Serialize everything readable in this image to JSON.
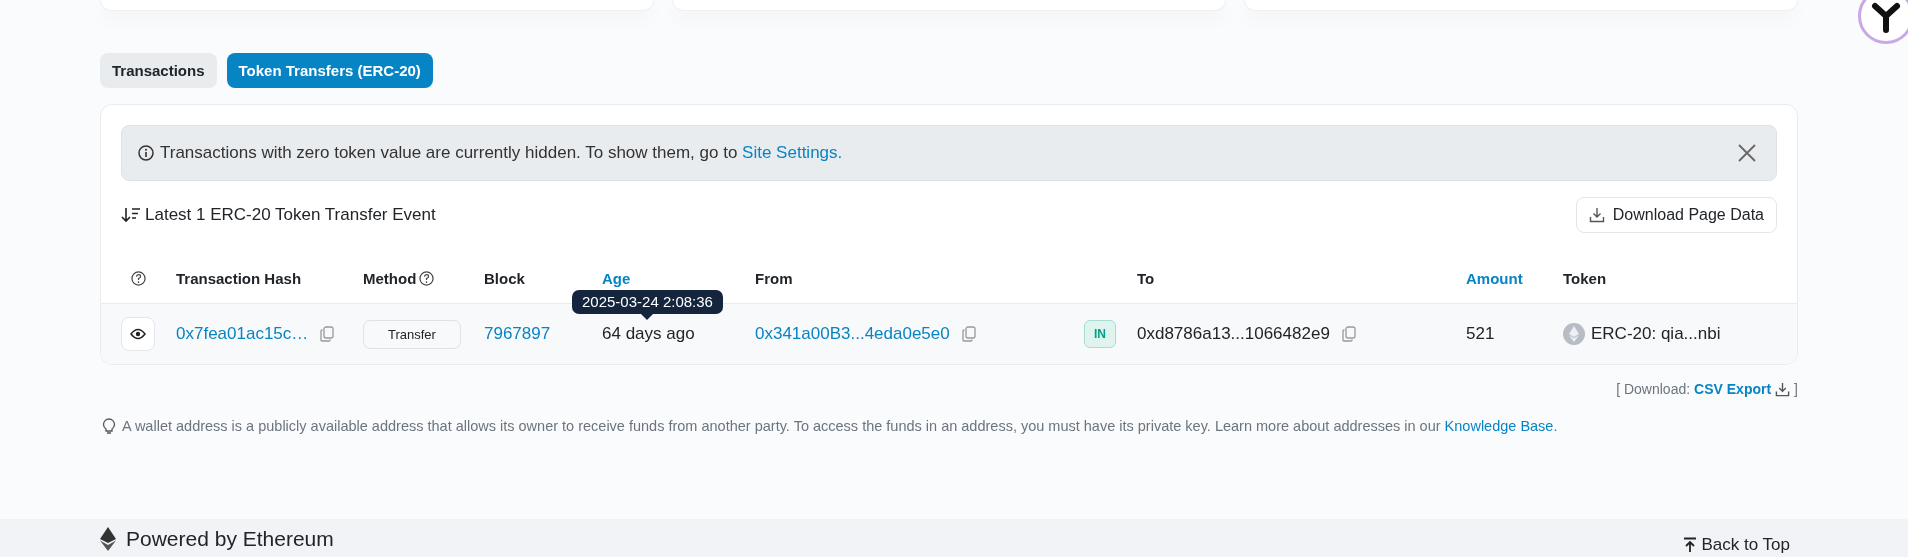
{
  "tabs": [
    {
      "label": "Transactions",
      "selected": false
    },
    {
      "label": "Token Transfers (ERC-20)",
      "selected": true
    }
  ],
  "notice": {
    "text": "Transactions with zero token value are currently hidden. To show them, go to",
    "link": "Site Settings."
  },
  "heading": "Latest 1 ERC-20 Token Transfer Event",
  "download_button": "Download Page Data",
  "table": {
    "columns": [
      {
        "label": "Transaction Hash",
        "kind": "plain"
      },
      {
        "label": "Method",
        "kind": "help"
      },
      {
        "label": "Block",
        "kind": "plain"
      },
      {
        "label": "Age",
        "kind": "sortable"
      },
      {
        "label": "From",
        "kind": "plain"
      },
      {
        "label": "To",
        "kind": "plain"
      },
      {
        "label": "Amount",
        "kind": "sortable"
      },
      {
        "label": "Token",
        "kind": "plain"
      }
    ],
    "rows": [
      {
        "tx_hash": "0x7fea01ac15c…",
        "method": "Transfer",
        "block": "7967897",
        "age": "64 days ago",
        "age_tooltip": "2025-03-24 2:08:36",
        "from": "0x341a00B3...4eda0e5e0",
        "direction": "IN",
        "to": "0xd8786a13...1066482e9",
        "amount": "521",
        "token": "ERC-20: qia...nbi"
      }
    ]
  },
  "csv": {
    "prefix": "[ Download:",
    "link": "CSV Export",
    "suffix": "]"
  },
  "note": {
    "text": "A wallet address is a publicly available address that allows its owner to receive funds from another party. To access the funds in an address, you must have its private key. Learn more about addresses in our",
    "link": "Knowledge Base",
    "end": "."
  },
  "footer": {
    "powered_by": "Powered by Ethereum",
    "back_to_top": "Back to Top"
  }
}
